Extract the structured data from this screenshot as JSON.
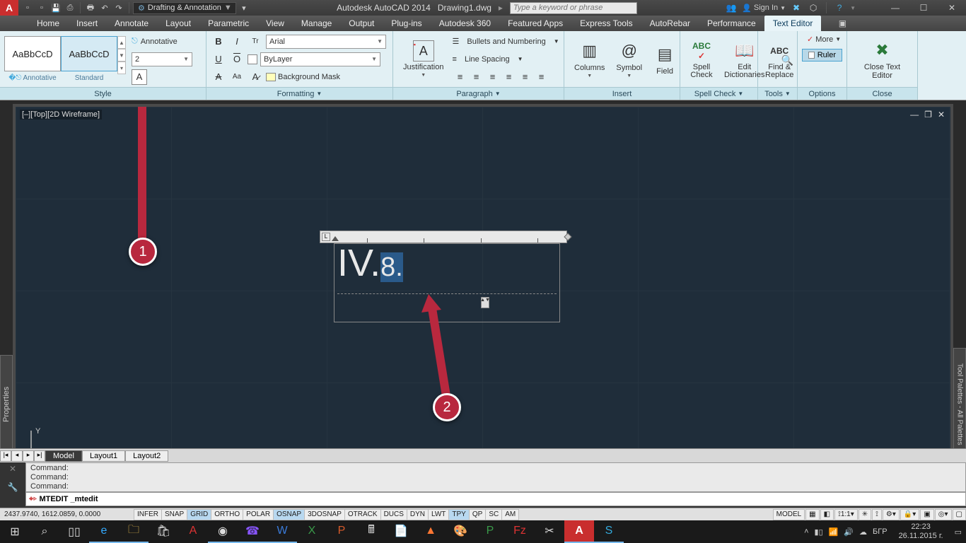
{
  "title": {
    "app": "Autodesk AutoCAD 2014",
    "doc": "Drawing1.dwg",
    "workspace": "Drafting & Annotation",
    "search_placeholder": "Type a keyword or phrase",
    "signin": "Sign In"
  },
  "tabs": [
    "Home",
    "Insert",
    "Annotate",
    "Layout",
    "Parametric",
    "View",
    "Manage",
    "Output",
    "Plug-ins",
    "Autodesk 360",
    "Featured Apps",
    "Express Tools",
    "AutoRebar",
    "Performance",
    "Text Editor"
  ],
  "active_tab": "Text Editor",
  "ribbon": {
    "style": {
      "title": "Style",
      "annotative": "Annotative",
      "standard": "Standard",
      "annotative_btn": "Annotative",
      "height": "2",
      "sample": "AaBbCcD"
    },
    "formatting": {
      "title": "Formatting",
      "font": "Arial",
      "layer": "ByLayer",
      "bgmask": "Background Mask"
    },
    "paragraph": {
      "title": "Paragraph",
      "justification": "Justification",
      "bullets": "Bullets and Numbering",
      "linespacing": "Line Spacing"
    },
    "insert": {
      "title": "Insert",
      "columns": "Columns",
      "symbol": "Symbol",
      "field": "Field"
    },
    "spellcheck": {
      "title": "Spell Check",
      "spell": "Spell Check",
      "dict": "Edit Dictionaries"
    },
    "tools": {
      "title": "Tools",
      "find": "Find & Replace"
    },
    "options": {
      "title": "Options",
      "more": "More",
      "ruler": "Ruler"
    },
    "close": {
      "title": "Close",
      "btn": "Close Text Editor"
    }
  },
  "viewport": {
    "label": "[–][Top][2D Wireframe]",
    "text_big": "IV.",
    "text_small": "8."
  },
  "side": {
    "left": "Properties",
    "right": "Tool Palettes - All Palettes"
  },
  "layout_tabs": [
    "Model",
    "Layout1",
    "Layout2"
  ],
  "cmd": {
    "h1": "Command:",
    "h2": "Command:",
    "h3": "Command:",
    "line": "MTEDIT _mtedit"
  },
  "status": {
    "coords": "2437.9740, 1612.0859, 0.0000",
    "toggles": [
      "INFER",
      "SNAP",
      "GRID",
      "ORTHO",
      "POLAR",
      "OSNAP",
      "3DOSNAP",
      "OTRACK",
      "DUCS",
      "DYN",
      "LWT",
      "TPY",
      "QP",
      "SC",
      "AM"
    ],
    "toggles_on": [
      "GRID",
      "OSNAP",
      "TPY"
    ],
    "model": "MODEL",
    "scale": "1:1"
  },
  "anno": {
    "n1": "1",
    "n2": "2"
  },
  "taskbar": {
    "lang": "БГР",
    "time": "22:23",
    "date": "26.11.2015 г."
  }
}
